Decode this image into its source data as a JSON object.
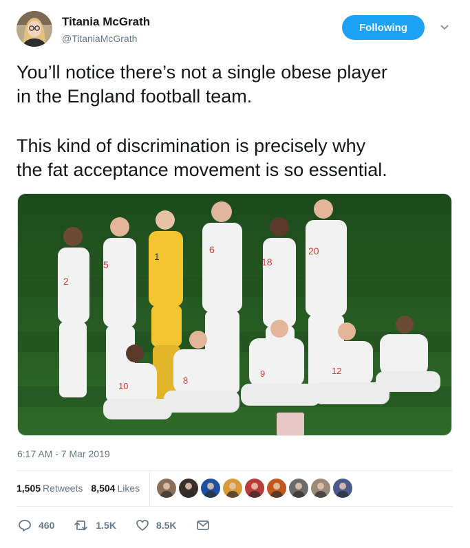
{
  "author": {
    "name": "Titania McGrath",
    "handle": "@TitaniaMcGrath",
    "avatar_icon": "profile-avatar"
  },
  "follow_button": {
    "label": "Following",
    "color": "#1da1f2"
  },
  "tweet": {
    "lines_para1": [
      "You’ll notice there’s not a single obese player",
      "in the England football team."
    ],
    "lines_para2": [
      "This kind of discrimination is precisely why",
      "the fat acceptance movement is so essential."
    ]
  },
  "photo": {
    "shirt_numbers": [
      "2",
      "5",
      "1",
      "6",
      "18",
      "20",
      "10",
      "8",
      "9",
      "12"
    ],
    "icon": "team-photo"
  },
  "timestamp": "6:17 AM - 7 Mar 2019",
  "stats": {
    "retweets_count": "1,505",
    "retweets_label": "Retweets",
    "likes_count": "8,504",
    "likes_label": "Likes"
  },
  "liker_avatars": [
    "#8a6e5a",
    "#3a2e2a",
    "#1f4fa0",
    "#d89a3a",
    "#b83a3a",
    "#c2571f",
    "#6b6b6b",
    "#9a8a7a",
    "#4a5a8a"
  ],
  "actions": {
    "reply_count": "460",
    "retweet_count": "1.5K",
    "like_count": "8.5K"
  },
  "colors": {
    "text": "#14171a",
    "muted": "#657786",
    "accent": "#1da1f2",
    "divider": "#e6ecf0"
  }
}
